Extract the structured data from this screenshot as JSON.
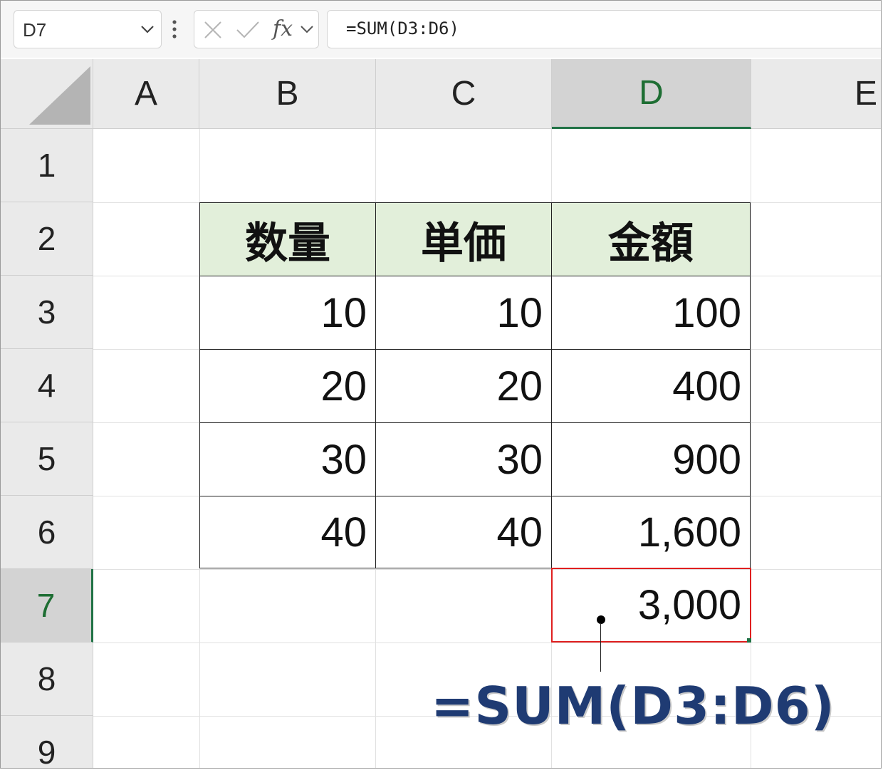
{
  "formula_bar": {
    "name_box": "D7",
    "fx_label": "fx",
    "formula": "=SUM(D3:D6)"
  },
  "columns": [
    "A",
    "B",
    "C",
    "D",
    "E"
  ],
  "selected_column": "D",
  "rows": [
    "1",
    "2",
    "3",
    "4",
    "5",
    "6",
    "7",
    "8",
    "9"
  ],
  "selected_row": "7",
  "table": {
    "headers": [
      "数量",
      "単価",
      "金額"
    ],
    "rows": [
      [
        "10",
        "10",
        "100"
      ],
      [
        "20",
        "20",
        "400"
      ],
      [
        "30",
        "30",
        "900"
      ],
      [
        "40",
        "40",
        "1,600"
      ]
    ],
    "total": "3,000"
  },
  "annotation": {
    "formula_callout": "=SUM(D3:D6)"
  },
  "colors": {
    "header_fill": "#e2efda",
    "selection_green": "#217346",
    "active_cell_border": "#e02020",
    "callout_text": "#1f3b73"
  }
}
